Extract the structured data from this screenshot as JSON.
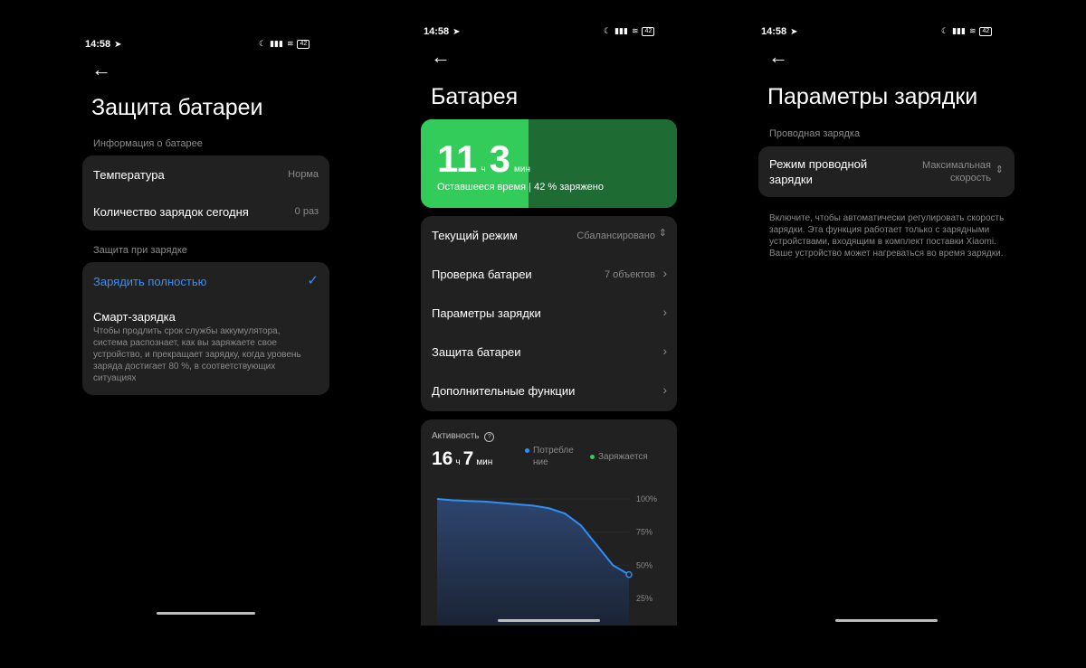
{
  "time": "14:58",
  "battery_level": "42",
  "left": {
    "title": "Защита батареи",
    "section1": "Информация о батарее",
    "temp_label": "Температура",
    "temp_value": "Норма",
    "charges_label": "Количество зарядок сегодня",
    "charges_value": "0 раз",
    "section2": "Защита при зарядке",
    "full_charge": "Зарядить полностью",
    "smart_title": "Смарт-зарядка",
    "smart_desc": "Чтобы продлить срок службы аккумулятора, система распознает, как вы заряжаете свое устройство, и прекращает зарядку, когда уровень заряда достигает 80 %, в соответствующих ситуациях"
  },
  "middle": {
    "title": "Батарея",
    "hours": "11",
    "hours_unit": "ч",
    "minutes": "3",
    "minutes_unit": "мин",
    "remaining": "Оставшееся время | 42 % заряжено",
    "charge_fraction": 0.42,
    "menu": [
      {
        "label": "Текущий режим",
        "value": "Сбалансировано"
      },
      {
        "label": "Проверка батареи",
        "value": "7 объектов"
      },
      {
        "label": "Параметры зарядки",
        "value": ""
      },
      {
        "label": "Защита батареи",
        "value": ""
      },
      {
        "label": "Дополнительные функции",
        "value": ""
      }
    ],
    "activity_label": "Активность",
    "act_hours": "16",
    "act_hours_unit": "ч",
    "act_minutes": "7",
    "act_minutes_unit": "мин",
    "legend_consumption": "Потребле ние",
    "legend_charging": "Заряжается",
    "colors": {
      "accent": "#2f8ff5",
      "green": "#33cc5a",
      "green_dark": "#1e6b34"
    }
  },
  "chart_data": {
    "type": "area",
    "y_ticks": [
      "100%",
      "75%",
      "50%",
      "25%"
    ],
    "ylim": [
      25,
      100
    ],
    "values": [
      100,
      99,
      98.5,
      98,
      97,
      96,
      95,
      93,
      89,
      80,
      65,
      50,
      43
    ]
  },
  "right": {
    "title": "Параметры зарядки",
    "section": "Проводная зарядка",
    "mode_label": "Режим проводной зарядки",
    "mode_value": "Максимальная скорость",
    "desc": "Включите, чтобы автоматически регулировать скорость зарядки. Эта функция работает только с зарядными устройствами, входящим в комплект поставки Xiaomi. Ваше устройство может нагреваться во время зарядки."
  }
}
